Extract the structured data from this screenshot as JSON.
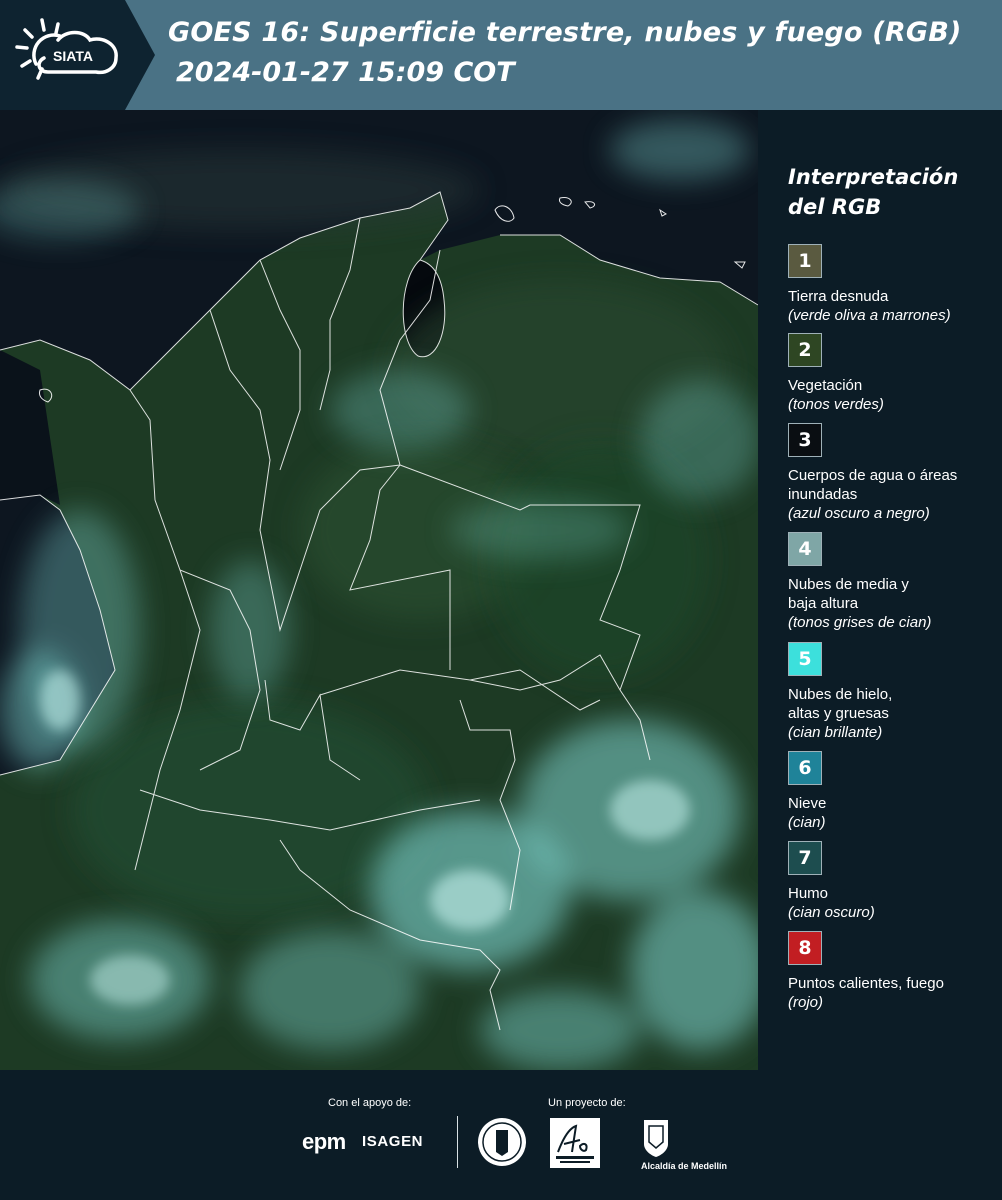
{
  "header": {
    "logo_text": "SIATA",
    "title": "GOES 16: Superficie terrestre, nubes y fuego (RGB)",
    "datetime": "2024-01-27 15:09 COT"
  },
  "legend": {
    "title": "Interpretación del RGB",
    "items": [
      {
        "number": "1",
        "label": "Tierra desnuda",
        "note": "(verde oliva a marrones)",
        "color": "#5a5a40"
      },
      {
        "number": "2",
        "label": "Vegetación",
        "note": "(tonos verdes)",
        "color": "#2e4623"
      },
      {
        "number": "3",
        "label": "Cuerpos de agua o áreas inundadas",
        "note": "(azul oscuro a negro)",
        "color": "#0a0e12"
      },
      {
        "number": "4",
        "label": "Nubes de media y baja altura",
        "note": "(tonos grises de cian)",
        "color": "#7fa6a6"
      },
      {
        "number": "5",
        "label": "Nubes de hielo, altas y gruesas",
        "note": "(cian brillante)",
        "color": "#3ce0dc"
      },
      {
        "number": "6",
        "label": "Nieve",
        "note": "(cian)",
        "color": "#1f8399"
      },
      {
        "number": "7",
        "label": "Humo",
        "note": "(cian oscuro)",
        "color": "#1d4d4f"
      },
      {
        "number": "8",
        "label": "Puntos calientes, fuego",
        "note": "(rojo)",
        "color": "#c21e22"
      }
    ]
  },
  "footer": {
    "support_label": "Con el apoyo de:",
    "project_label": "Un proyecto de:",
    "epm": "epm",
    "isagen": "ISAGEN",
    "alcaldia": "Alcaldía de Medellín"
  }
}
